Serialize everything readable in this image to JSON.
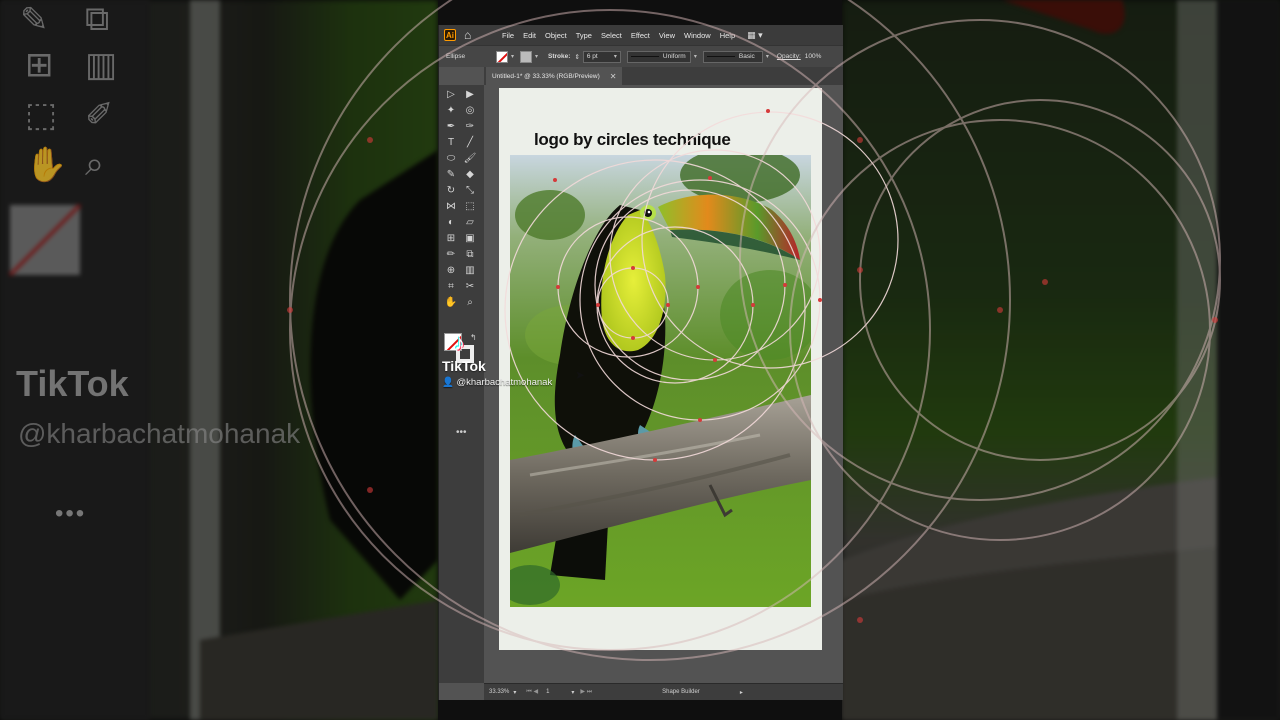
{
  "menubar": {
    "items": [
      "File",
      "Edit",
      "Object",
      "Type",
      "Select",
      "Effect",
      "View",
      "Window",
      "Help"
    ]
  },
  "controlbar": {
    "selection_label": "Ellipse",
    "stroke_label": "Stroke:",
    "stroke_value": "6 pt",
    "profile_label": "Uniform",
    "brush_label": "Basic",
    "opacity_label": "Opacity:",
    "opacity_value": "100%"
  },
  "document": {
    "tab_title": "Untitled-1* @ 33.33% (RGB/Preview)",
    "headline": "logo by circles technique"
  },
  "statusbar": {
    "zoom": "33.33%",
    "artboard_number": "1",
    "current_tool": "Shape Builder"
  },
  "watermark": {
    "brand": "TikTok",
    "handle": "@kharbachatmohanak"
  },
  "colors": {
    "accent": "#ff9a00",
    "guide_circle": "#e7c6c6",
    "anchor_point": "#cc3333"
  }
}
